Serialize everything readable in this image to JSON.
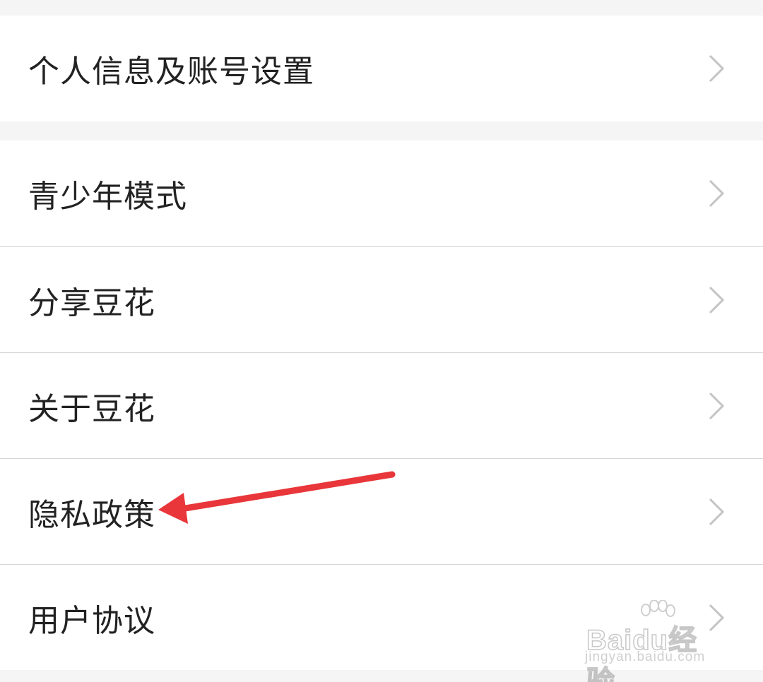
{
  "settings": {
    "group1": [
      {
        "label": "个人信息及账号设置"
      }
    ],
    "group2": [
      {
        "label": "青少年模式"
      },
      {
        "label": "分享豆花"
      },
      {
        "label": "关于豆花"
      },
      {
        "label": "隐私政策"
      },
      {
        "label": "用户协议"
      }
    ]
  },
  "annotation": {
    "arrow_color": "#e8363a",
    "target": "隐私政策"
  },
  "watermark": {
    "brand": "Bai",
    "brand_suffix": "du",
    "product": "经验",
    "url": "jingyan.baidu.com"
  },
  "icons": {
    "row_chevron": "chevron-right-icon"
  }
}
